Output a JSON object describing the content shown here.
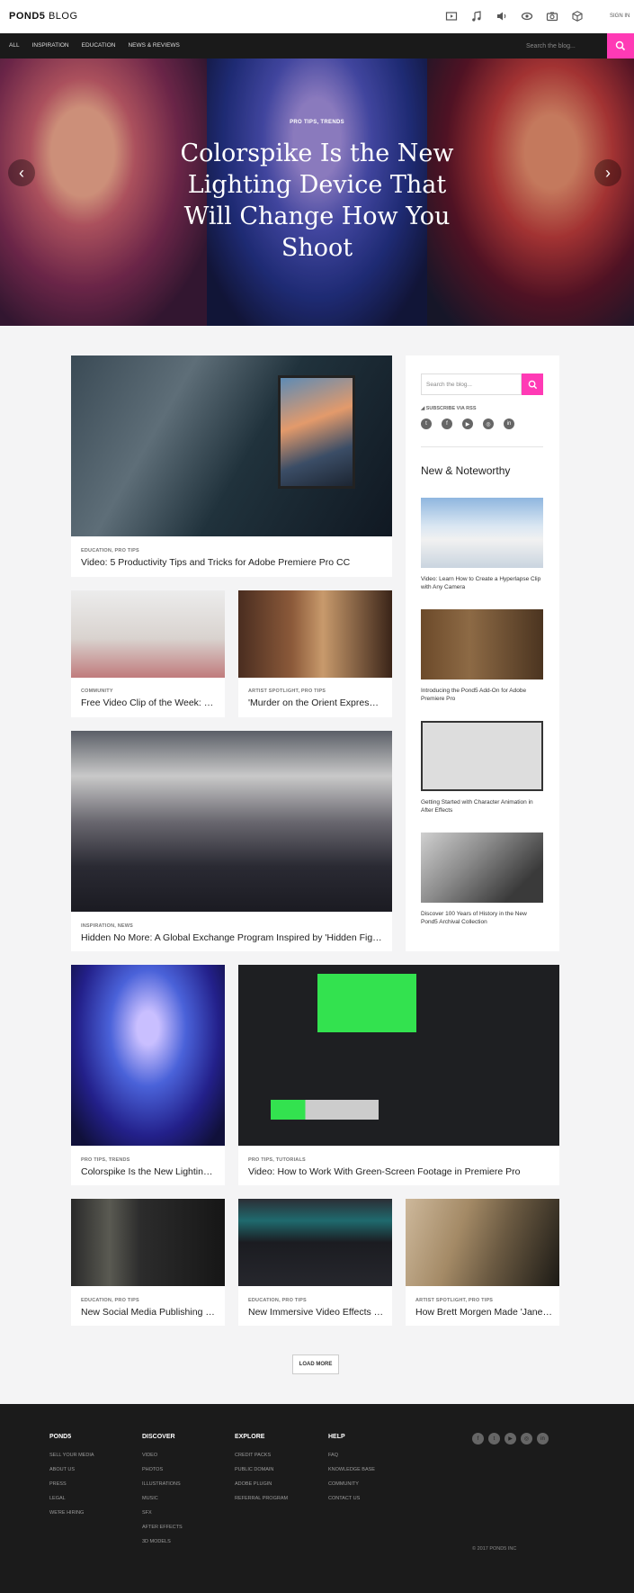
{
  "header": {
    "logo_bold": "POND5",
    "logo_light": " BLOG",
    "icons": [
      "video-icon",
      "music-icon",
      "sound-icon",
      "after-effects-icon",
      "photo-icon",
      "3d-icon"
    ],
    "signin": "SIGN IN"
  },
  "nav": {
    "links": [
      "ALL",
      "INSPIRATION",
      "EDUCATION",
      "NEWS & REVIEWS"
    ],
    "search_placeholder": "Search the blog..."
  },
  "hero": {
    "tags": "PRO TIPS, TRENDS",
    "title": "Colorspike Is the New Lighting Device That Will Change How You Shoot",
    "prev": "‹",
    "next": "›"
  },
  "posts": [
    {
      "tags": "EDUCATION, PRO TIPS",
      "title": "Video: 5 Productivity Tips and Tricks for Adobe Premiere Pro CC"
    },
    {
      "tags": "COMMUNITY",
      "title": "Free Video Clip of the Week: …"
    },
    {
      "tags": "ARTIST SPOTLIGHT, PRO TIPS",
      "title": "'Murder on the Orient Expres…"
    },
    {
      "tags": "INSPIRATION, NEWS",
      "title": "Hidden No More: A Global Exchange Program Inspired by 'Hidden Fig…"
    },
    {
      "tags": "PRO TIPS, TRENDS",
      "title": "Colorspike Is the New Lightin…"
    },
    {
      "tags": "PRO TIPS, TUTORIALS",
      "title": "Video: How to Work With Green-Screen Footage in Premiere Pro"
    },
    {
      "tags": "EDUCATION, PRO TIPS",
      "title": "New Social Media Publishing …"
    },
    {
      "tags": "EDUCATION, PRO TIPS",
      "title": "New Immersive Video Effects …"
    },
    {
      "tags": "ARTIST SPOTLIGHT, PRO TIPS",
      "title": "How Brett Morgen Made 'Jane…"
    }
  ],
  "sidebar": {
    "search_placeholder": "Search the blog...",
    "rss": "SUBSCRIBE VIA RSS",
    "social_icons": [
      "twitter-icon",
      "facebook-icon",
      "youtube-icon",
      "instagram-icon",
      "linkedin-icon"
    ],
    "heading": "New & Noteworthy",
    "items": [
      {
        "title": "Video: Learn How to Create a Hyperlapse Clip with Any Camera"
      },
      {
        "title": "Introducing the Pond5 Add-On for Adobe Premiere Pro"
      },
      {
        "title": "Getting Started with Character Animation in After Effects"
      },
      {
        "title": "Discover 100 Years of History in the New Pond5 Archival Collection"
      }
    ]
  },
  "load_more": "LOAD MORE",
  "footer": {
    "columns": [
      {
        "heading": "POND5",
        "links": [
          "SELL YOUR MEDIA",
          "ABOUT US",
          "PRESS",
          "LEGAL",
          "WE'RE HIRING"
        ]
      },
      {
        "heading": "DISCOVER",
        "links": [
          "VIDEO",
          "PHOTOS",
          "ILLUSTRATIONS",
          "MUSIC",
          "SFX",
          "AFTER EFFECTS",
          "3D MODELS"
        ]
      },
      {
        "heading": "EXPLORE",
        "links": [
          "CREDIT PACKS",
          "PUBLIC DOMAIN",
          "ADOBE PLUGIN",
          "REFERRAL PROGRAM"
        ]
      },
      {
        "heading": "HELP",
        "links": [
          "FAQ",
          "KNOWLEDGE BASE",
          "COMMUNITY",
          "CONTACT US"
        ]
      }
    ],
    "social_icons": [
      "facebook-icon",
      "twitter-icon",
      "youtube-icon",
      "instagram-icon",
      "linkedin-icon"
    ],
    "copyright": "© 2017 POND5 INC"
  }
}
